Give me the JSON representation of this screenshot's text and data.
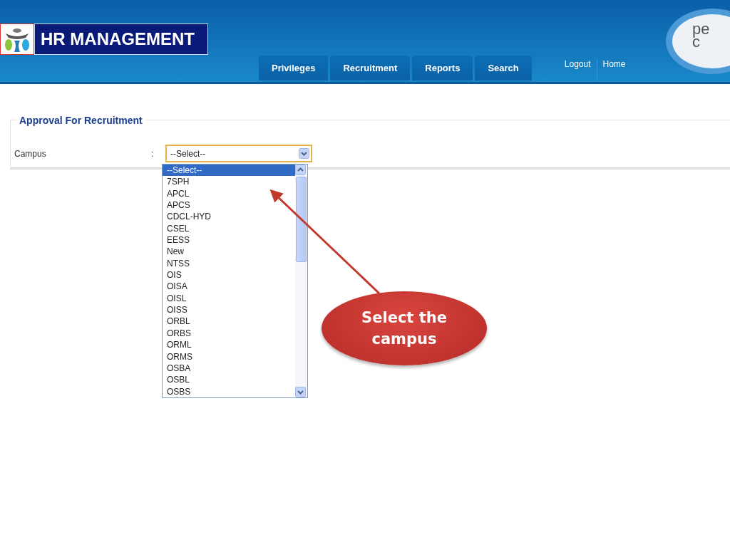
{
  "header": {
    "title": "HR MANAGEMENT",
    "tabs": [
      {
        "label": "Privileges",
        "selected": false
      },
      {
        "label": "Recruitment",
        "selected": false
      },
      {
        "label": "Reports",
        "selected": false
      },
      {
        "label": "Search",
        "selected": false
      }
    ],
    "links": [
      "Logout",
      "Home"
    ],
    "partner_logo": [
      "pe",
      "c"
    ]
  },
  "form": {
    "legend": "Approval For Recruitment",
    "fields": [
      {
        "label": "Campus",
        "separator": ":",
        "value": "--Select--"
      }
    ]
  },
  "dropdown": {
    "options": [
      {
        "label": "--Select--",
        "selected": true
      },
      {
        "label": "7SPH",
        "selected": false
      },
      {
        "label": "APCL",
        "selected": false
      },
      {
        "label": "APCS",
        "selected": false
      },
      {
        "label": "CDCL-HYD",
        "selected": false
      },
      {
        "label": "CSEL",
        "selected": false
      },
      {
        "label": "EESS",
        "selected": false
      },
      {
        "label": "New",
        "selected": false
      },
      {
        "label": "NTSS",
        "selected": false
      },
      {
        "label": "OIS",
        "selected": false
      },
      {
        "label": "OISA",
        "selected": false
      },
      {
        "label": "OISL",
        "selected": false
      },
      {
        "label": "OISS",
        "selected": false
      },
      {
        "label": "ORBL",
        "selected": false
      },
      {
        "label": "ORBS",
        "selected": false
      },
      {
        "label": "ORML",
        "selected": false
      },
      {
        "label": "ORMS",
        "selected": false
      },
      {
        "label": "OSBA",
        "selected": false
      },
      {
        "label": "OSBL",
        "selected": false
      },
      {
        "label": "OSBS",
        "selected": false
      }
    ]
  },
  "callout": {
    "text": "Select the campus"
  }
}
